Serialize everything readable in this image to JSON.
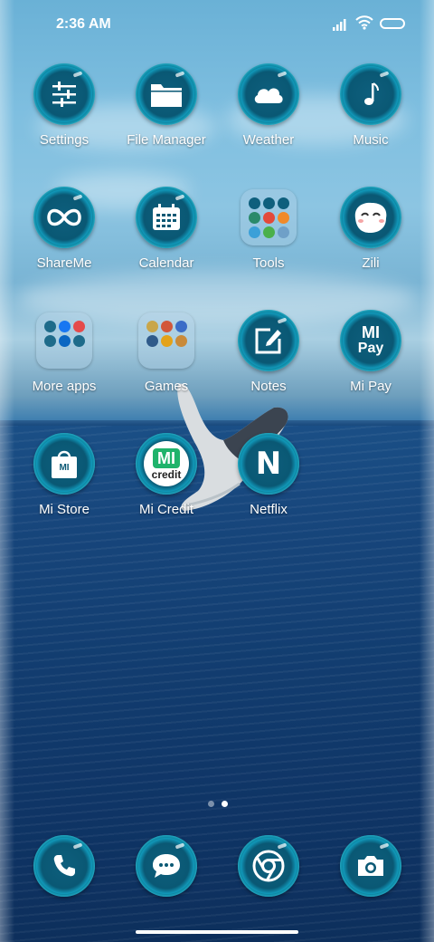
{
  "status_bar": {
    "time": "2:36 AM"
  },
  "apps": [
    {
      "label": "Settings",
      "icon": "sliders-icon"
    },
    {
      "label": "File Manager",
      "icon": "folder-icon"
    },
    {
      "label": "Weather",
      "icon": "cloud-icon"
    },
    {
      "label": "Music",
      "icon": "music-note-icon"
    },
    {
      "label": "ShareMe",
      "icon": "shareme-icon"
    },
    {
      "label": "Calendar",
      "icon": "calendar-icon"
    },
    {
      "label": "Tools",
      "icon": "tools-folder-icon"
    },
    {
      "label": "Zili",
      "icon": "zili-face-icon"
    },
    {
      "label": "More apps",
      "icon": "more-apps-folder-icon"
    },
    {
      "label": "Games",
      "icon": "games-folder-icon"
    },
    {
      "label": "Notes",
      "icon": "note-edit-icon"
    },
    {
      "label": "Mi Pay",
      "icon": "mi-pay-icon",
      "icon_text": "MI",
      "icon_subtext": "Pay"
    },
    {
      "label": "Mi Store",
      "icon": "shopping-bag-icon",
      "icon_text": "MI"
    },
    {
      "label": "Mi Credit",
      "icon": "mi-credit-icon",
      "icon_text": "MI",
      "icon_subtext": "credit"
    },
    {
      "label": "Netflix",
      "icon": "netflix-icon",
      "icon_text": "N"
    }
  ],
  "page_indicator": {
    "pages": 2,
    "active": 2
  },
  "dock": [
    {
      "icon": "phone-icon"
    },
    {
      "icon": "messages-icon"
    },
    {
      "icon": "chrome-icon"
    },
    {
      "icon": "camera-icon"
    }
  ],
  "colors": {
    "icon_ring": "#30cbe6",
    "icon_core": "#0a5874",
    "sea": "#17467c",
    "sky": "#7fbfe0"
  }
}
